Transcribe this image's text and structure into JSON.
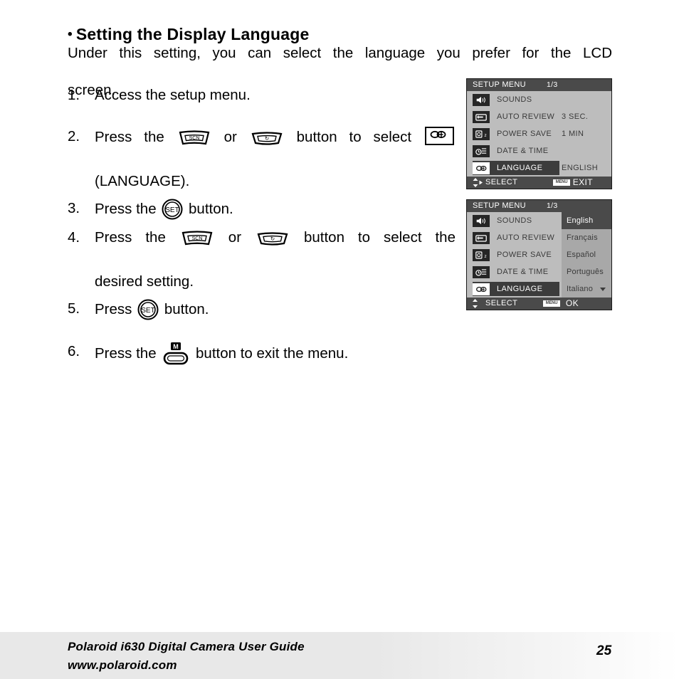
{
  "heading": {
    "bullet": "•",
    "text": "Setting the Display Language"
  },
  "intro": {
    "line1": "Under this setting, you can select the language you prefer for the LCD",
    "line2": "screen."
  },
  "steps": [
    {
      "num": "1.",
      "text": "Access the setup menu."
    },
    {
      "num": "2.",
      "pre": "Press the",
      "mid": "or",
      "post": "button to select",
      "line2": "(LANGUAGE)."
    },
    {
      "num": "3.",
      "pre": "Press the",
      "post": "button."
    },
    {
      "num": "4.",
      "pre": "Press the",
      "mid": "or",
      "post": "button to select the",
      "line2": "desired setting."
    },
    {
      "num": "5.",
      "pre": "Press",
      "post": "button."
    },
    {
      "num": "6.",
      "pre": "Press the",
      "post": "button to exit the menu."
    }
  ],
  "icons": {
    "scn_label": "SCN",
    "timer_label": "↺",
    "set_label": "SET",
    "menu_label": "M",
    "language_box": "language-icon"
  },
  "lcd1": {
    "title": "SETUP MENU",
    "page": "1/3",
    "rows": [
      {
        "icon": "speaker-icon",
        "label": "SOUNDS",
        "value": ""
      },
      {
        "icon": "auto-review-icon",
        "label": "AUTO REVIEW",
        "value": "3 SEC."
      },
      {
        "icon": "power-save-icon",
        "label": "POWER SAVE",
        "value": "1 MIN"
      },
      {
        "icon": "date-time-icon",
        "label": "DATE & TIME",
        "value": ""
      },
      {
        "icon": "language-icon",
        "label": "LANGUAGE",
        "value": "ENGLISH",
        "selected": true
      }
    ],
    "footer": {
      "select": "SELECT",
      "menu_badge": "MENU",
      "action": "EXIT"
    }
  },
  "lcd2": {
    "title": "SETUP MENU",
    "page": "1/3",
    "rows": [
      {
        "icon": "speaker-icon",
        "label": "SOUNDS",
        "value": ""
      },
      {
        "icon": "auto-review-icon",
        "label": "AUTO REVIEW",
        "value": ""
      },
      {
        "icon": "power-save-icon",
        "label": "POWER SAVE",
        "value": ""
      },
      {
        "icon": "date-time-icon",
        "label": "DATE & TIME",
        "value": ""
      },
      {
        "icon": "language-icon",
        "label": "LANGUAGE",
        "value": "",
        "selected": true
      }
    ],
    "languages": [
      {
        "label": "English",
        "selected": true
      },
      {
        "label": "Français",
        "selected": false
      },
      {
        "label": "Español",
        "selected": false
      },
      {
        "label": "Português",
        "selected": false
      },
      {
        "label": "Italiano",
        "selected": false,
        "caret": true
      }
    ],
    "footer": {
      "select": "SELECT",
      "menu_badge": "MENU",
      "action": "OK"
    }
  },
  "footer": {
    "line1": "Polaroid i630 Digital Camera User Guide",
    "line2": "www.polaroid.com",
    "page_number": "25"
  },
  "colors": {
    "lcd_bg": "#bdbdbd",
    "lcd_bar": "#4a4a4a",
    "lcd_icon": "#262626",
    "lcd_panel": "#a8a8a8",
    "footer_band": "#e8e8e8"
  }
}
